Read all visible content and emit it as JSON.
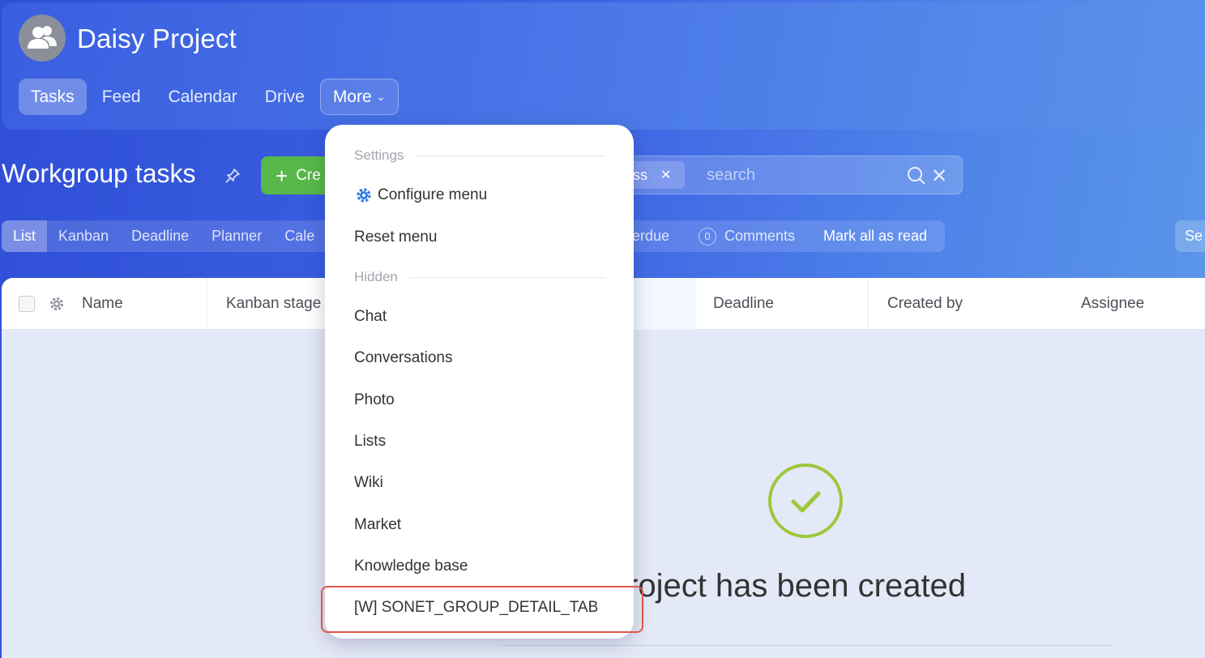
{
  "project": {
    "title": "Daisy Project"
  },
  "nav": {
    "tabs": [
      "Tasks",
      "Feed",
      "Calendar",
      "Drive"
    ],
    "more_label": "More"
  },
  "toolbar": {
    "page_title": "Workgroup tasks",
    "create_label": "Cre",
    "filter_chip": "ss",
    "search_placeholder": "search"
  },
  "views": {
    "tabs": [
      "List",
      "Kanban",
      "Deadline",
      "Planner",
      "Cale"
    ],
    "overdue_label": "erdue",
    "comments_count": "0",
    "comments_label": "Comments",
    "mark_all_read": "Mark all as read",
    "right_button": "Se"
  },
  "grid": {
    "columns": [
      "Name",
      "Kanban stage",
      "Deadline",
      "Created by",
      "Assignee"
    ],
    "empty_message": "roject has been created"
  },
  "menu": {
    "settings_section": "Settings",
    "configure": "Configure menu",
    "reset": "Reset menu",
    "hidden_section": "Hidden",
    "items": [
      "Chat",
      "Conversations",
      "Photo",
      "Lists",
      "Wiki",
      "Market",
      "Knowledge base",
      "[W] SONET_GROUP_DETAIL_TAB"
    ]
  },
  "colors": {
    "accent_green": "#57b849",
    "success_check": "#9cc83a",
    "highlight_red": "#e25547",
    "gear_blue": "#2d7be6"
  }
}
